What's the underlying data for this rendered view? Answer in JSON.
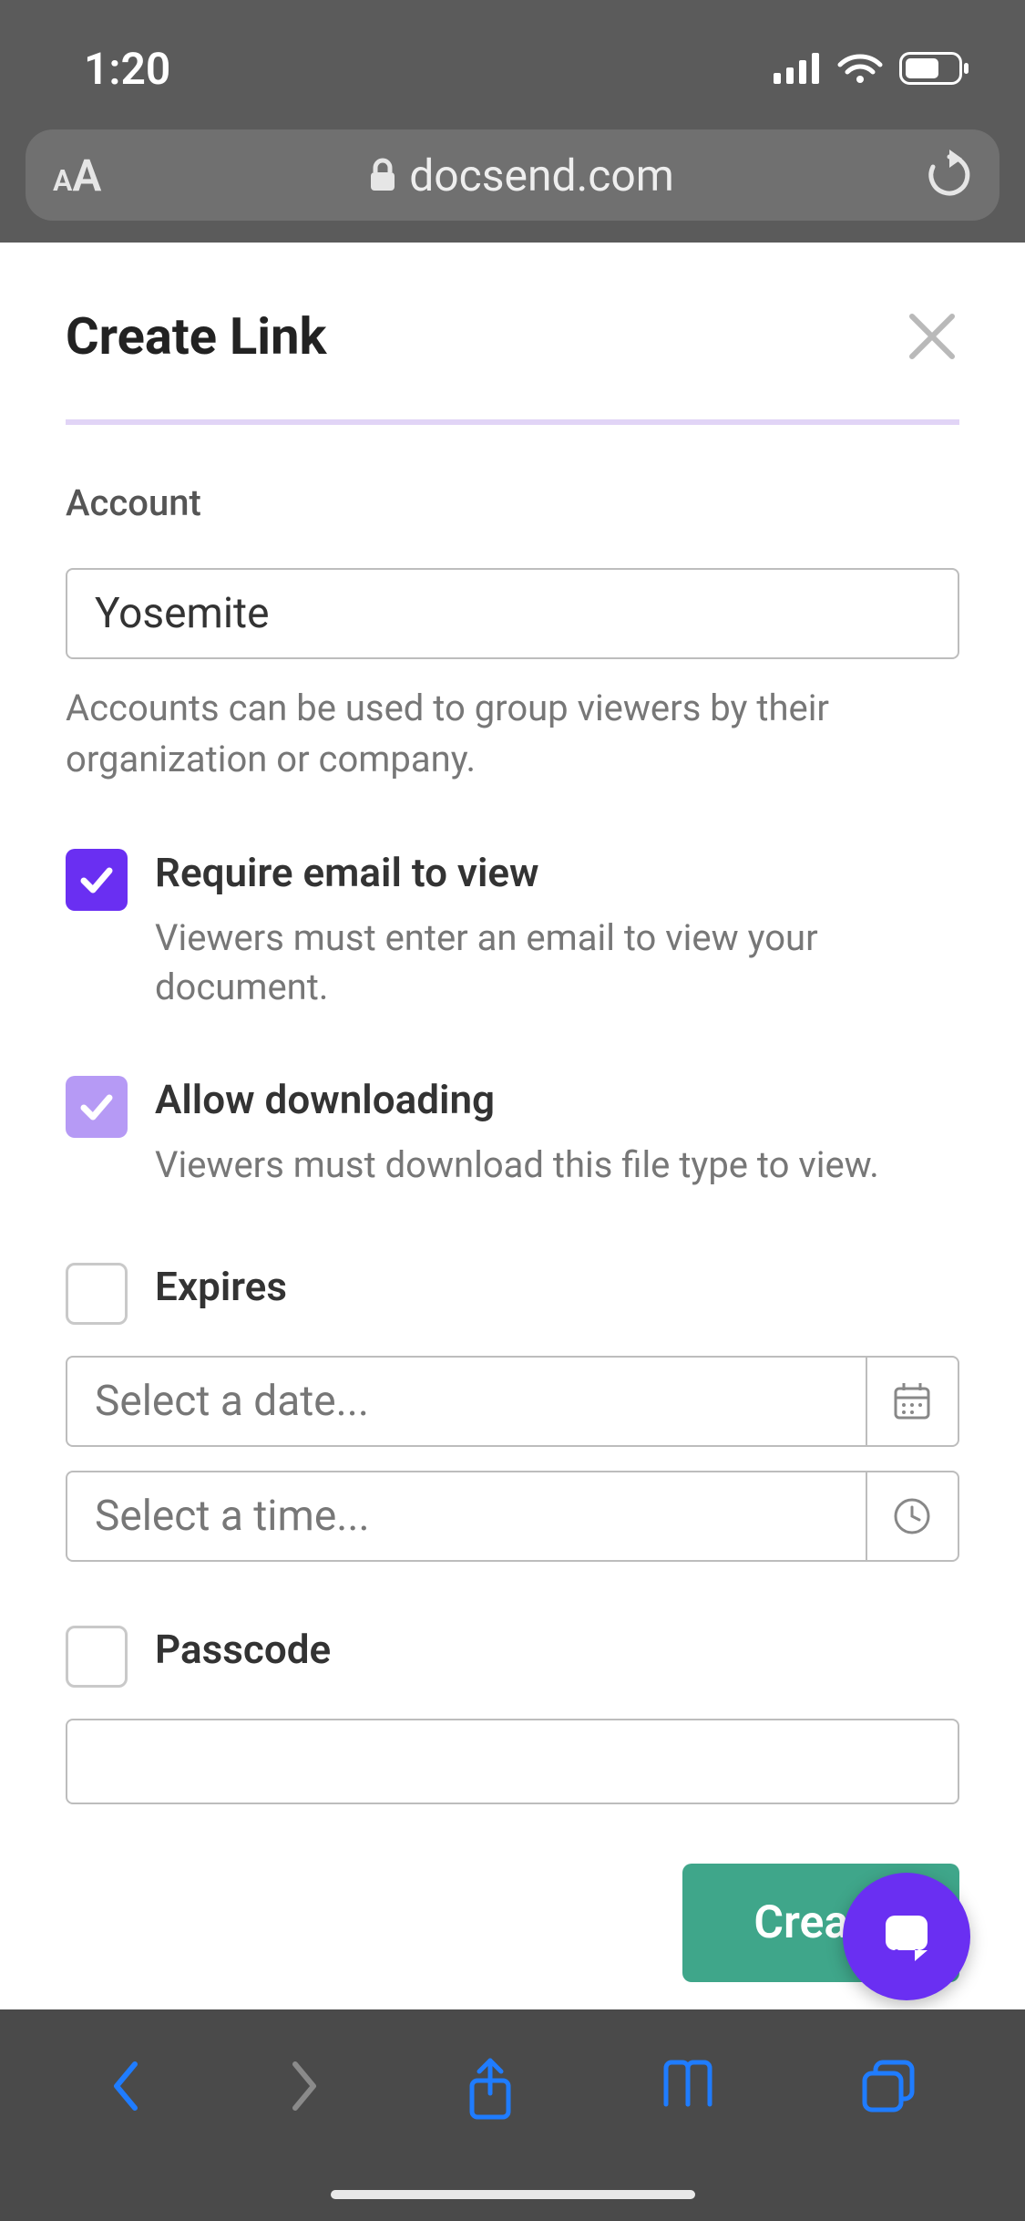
{
  "status": {
    "time": "1:20"
  },
  "browser": {
    "domain": "docsend.com"
  },
  "modal": {
    "title": "Create Link",
    "account": {
      "label": "Account",
      "value": "Yosemite",
      "help": "Accounts can be used to group viewers by their organization or company."
    },
    "require_email": {
      "title": "Require email to view",
      "desc": "Viewers must enter an email to view your document.",
      "checked": true
    },
    "allow_download": {
      "title": "Allow downloading",
      "desc": "Viewers must download this file type to view.",
      "checked": true
    },
    "expires": {
      "title": "Expires",
      "date_placeholder": "Select a date...",
      "time_placeholder": "Select a time...",
      "checked": false
    },
    "passcode": {
      "title": "Passcode",
      "value": "",
      "checked": false
    },
    "create_button": "Create"
  }
}
